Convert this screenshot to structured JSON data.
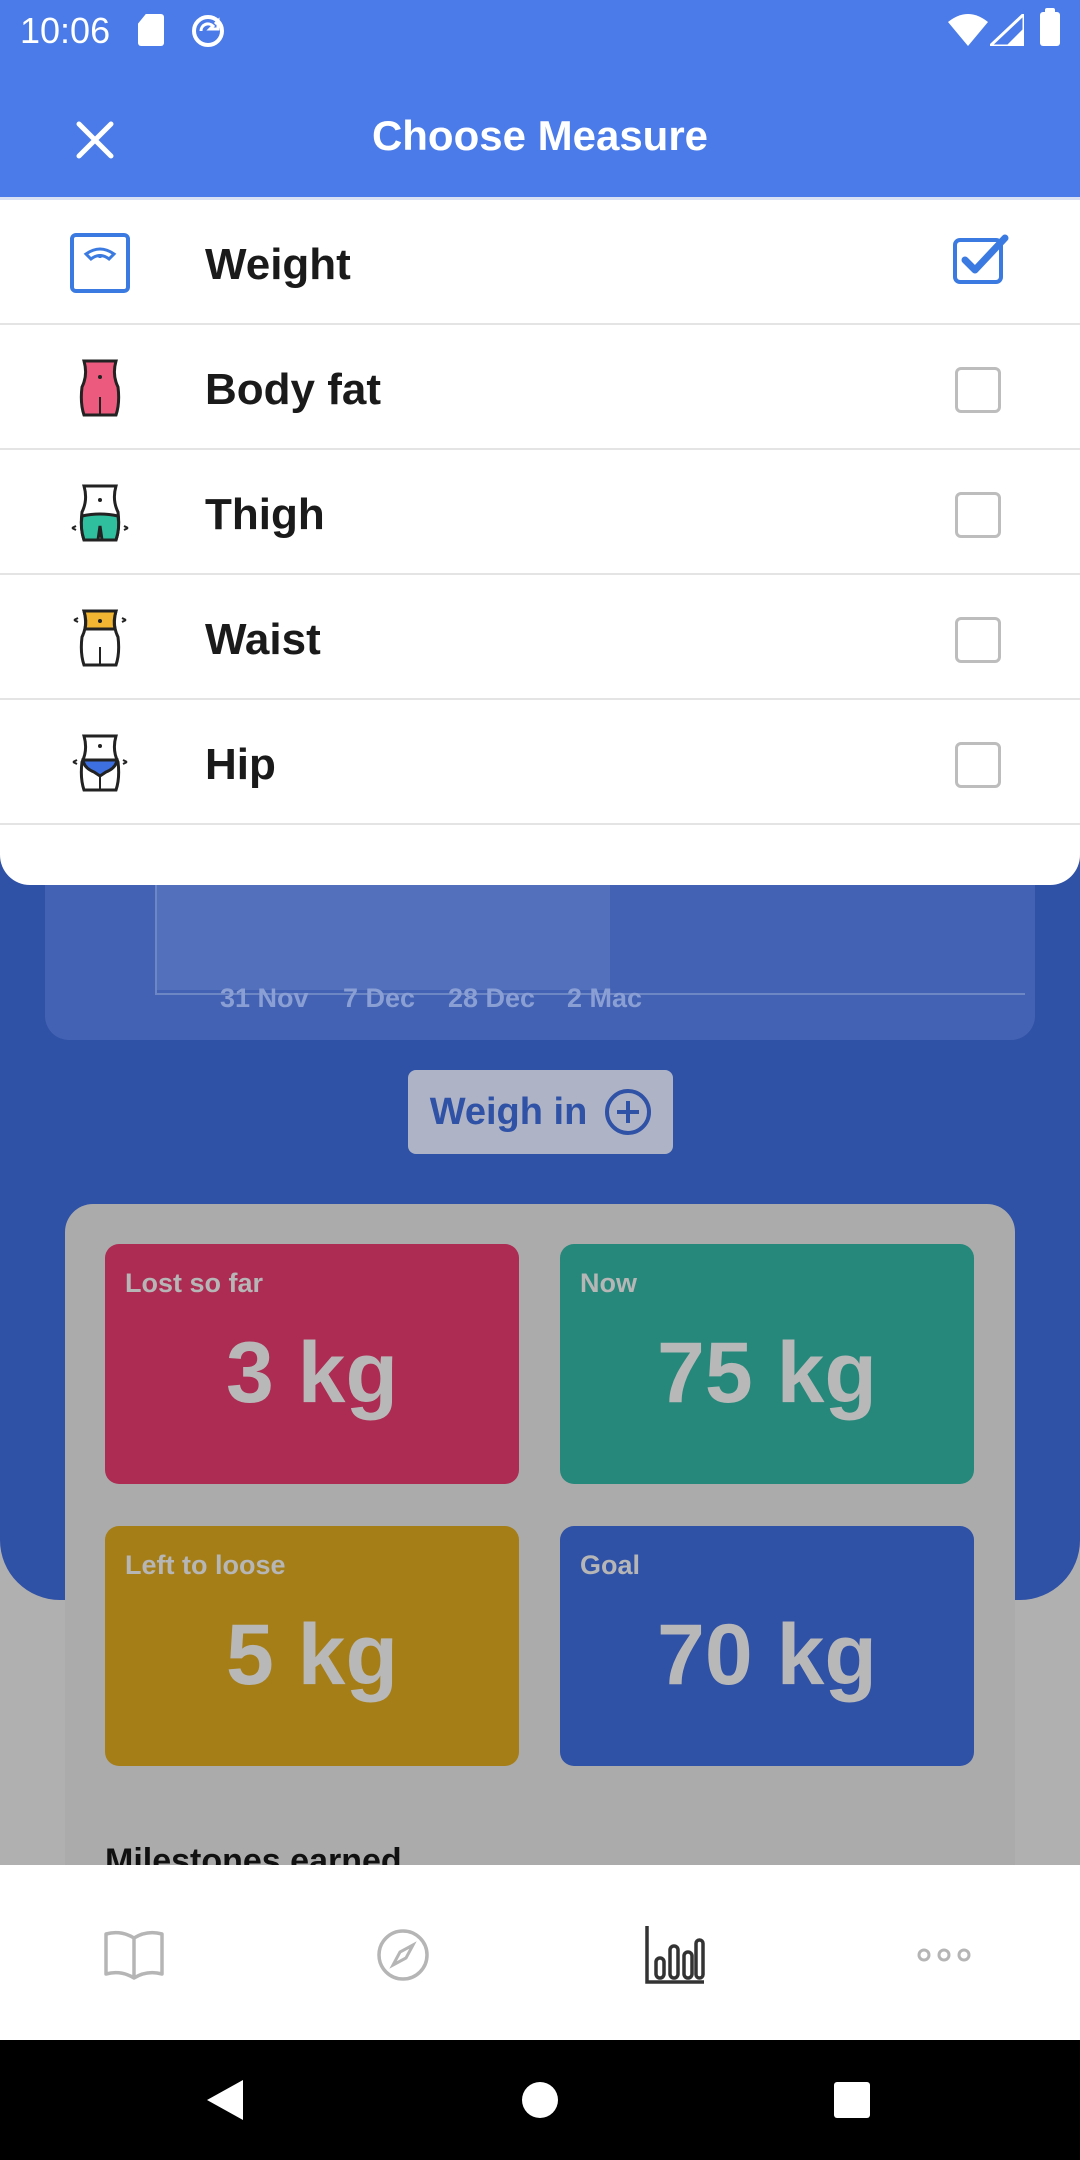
{
  "status_bar": {
    "time": "10:06"
  },
  "app_bar": {
    "title": "Choose Measure"
  },
  "measures": [
    {
      "label": "Weight",
      "checked": true
    },
    {
      "label": "Body fat",
      "checked": false
    },
    {
      "label": "Thigh",
      "checked": false
    },
    {
      "label": "Waist",
      "checked": false
    },
    {
      "label": "Hip",
      "checked": false
    }
  ],
  "chart": {
    "x_labels": [
      "31 Nov",
      "7 Dec",
      "28 Dec",
      "2 Mac"
    ]
  },
  "weigh_in": {
    "label": "Weigh in"
  },
  "stats": {
    "lost": {
      "label": "Lost so far",
      "value": "3 kg"
    },
    "now": {
      "label": "Now",
      "value": "75 kg"
    },
    "left": {
      "label": "Left to loose",
      "value": "5 kg"
    },
    "goal": {
      "label": "Goal",
      "value": "70 kg"
    }
  },
  "milestones": {
    "title": "Milestones earned"
  },
  "bottom_nav": [
    "book-icon",
    "compass-icon",
    "bar-chart-icon",
    "more-icon"
  ],
  "colors": {
    "primary": "#4a7be8",
    "dark_blue": "#2f51a6",
    "checkbox_checked": "#3b7ae0",
    "lost_tile": "#ac2c53",
    "now_tile": "#26887b",
    "left_tile": "#a67e17",
    "goal_tile": "#2f51a6"
  }
}
